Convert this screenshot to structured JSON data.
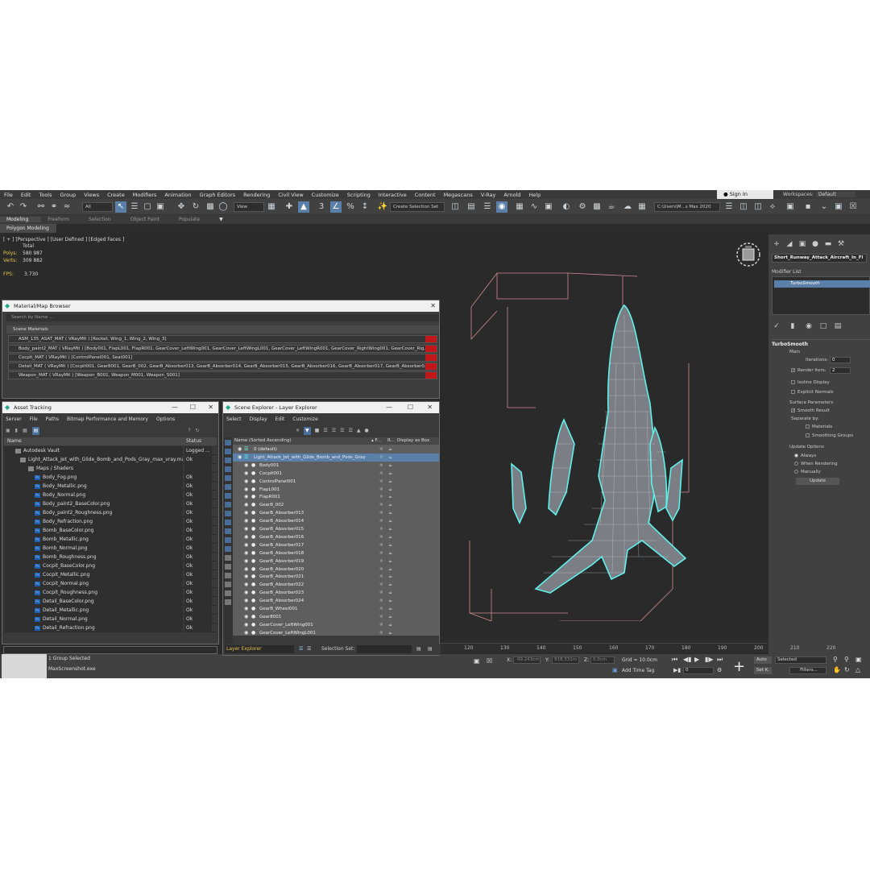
{
  "menu": [
    "File",
    "Edit",
    "Tools",
    "Group",
    "Views",
    "Create",
    "Modifiers",
    "Animation",
    "Graph Editors",
    "Rendering",
    "Civil View",
    "Customize",
    "Scripting",
    "Interactive",
    "Content",
    "Megascans",
    "V-Ray",
    "Arnold",
    "Help"
  ],
  "signin": "Sign In",
  "workspaces_label": "Workspaces:",
  "workspace_value": "Default",
  "toolbar": {
    "filter_all": "All",
    "view_drop": "View",
    "create_selection_set": "Create Selection Set",
    "project_path": "C:\\Users\\M...s Max 2020"
  },
  "ribbon_tabs": [
    "Modeling",
    "Freeform",
    "Selection",
    "Object Paint",
    "Populate"
  ],
  "ribbon_sub": "Polygon Modeling",
  "viewport": {
    "label": "[ + ] [Perspective ] [User Defined ] [Edged Faces ]",
    "total_label": "Total",
    "polys_label": "Polys:",
    "polys_value": "580 987",
    "verts_label": "Verts:",
    "verts_value": "309 882",
    "fps_label": "FPS:",
    "fps_value": "3.730"
  },
  "right_panel": {
    "object_name": "Short_Runway_Attack_Aircraft_In_Fl",
    "modifier_list_label": "Modifier List",
    "modifier": "TurboSmooth",
    "rollout_title": "TurboSmooth",
    "main_label": "Main",
    "iterations_label": "Iterations:",
    "iterations_value": "0",
    "render_iters_label": "Render Iters:",
    "render_iters_value": "2",
    "isoline": "Isoline Display",
    "explicit": "Explicit Normals",
    "surface_params": "Surface Parameters",
    "smooth_result": "Smooth Result",
    "separate_by": "Separate by:",
    "materials": "Materials",
    "smoothing_groups": "Smoothing Groups",
    "update_options": "Update Options",
    "always": "Always",
    "when_rendering": "When Rendering",
    "manually": "Manually",
    "update_btn": "Update"
  },
  "material_browser": {
    "title": "Material/Map Browser",
    "search": "Search by Name ...",
    "section": "Scene Materials",
    "rows": [
      "ASM_135_ASAT_MAT  ( VRayMtl )  [Rocket, Wing_1, Wing_2, Wing_3]",
      "Body_paint2_MAT  ( VRayMtl )  [Body001, FlapL001, FlapR001, GearCover_LeftWing001, GearCover_LeftWingL001, GearCover_LeftWingR001, GearCover_RightWing001, GearCover_Rig...",
      "Cocpit_MAT  ( VRayMtl )  [ControlPanel001, Seat001]",
      "Detail_MAT  ( VRayMtl )  [Cocpit001, Gear8001, GearB_002, GearB_Absorber013, GearB_Absorber014, GearB_Absorber015, GearB_Absorber016, GearB_Absorber017, GearB_Absorber0...",
      "Weapon_MAT  ( VRayMtl )  [Weapon_B001, Weapon_M001, Weapon_S001]"
    ]
  },
  "asset_tracking": {
    "title": "Asset Tracking",
    "menu": [
      "Server",
      "File",
      "Paths",
      "Bitmap Performance and Memory",
      "Options"
    ],
    "col_name": "Name",
    "col_status": "Status",
    "rows": [
      {
        "name": "Autodesk Vault",
        "status": "Logged ..."
      },
      {
        "name": "Light_Attack_Jet_with_Glide_Bomb_and_Pods_Gray_max_vray.max",
        "status": "Ok"
      },
      {
        "name": "Maps / Shaders",
        "status": ""
      },
      {
        "name": "Body_Fog.png",
        "status": "Ok"
      },
      {
        "name": "Body_Metallic.png",
        "status": "Ok"
      },
      {
        "name": "Body_Normal.png",
        "status": "Ok"
      },
      {
        "name": "Body_paint2_BaseColor.png",
        "status": "Ok"
      },
      {
        "name": "Body_paint2_Roughness.png",
        "status": "Ok"
      },
      {
        "name": "Body_Refraction.png",
        "status": "Ok"
      },
      {
        "name": "Bomb_BaseColor.png",
        "status": "Ok"
      },
      {
        "name": "Bomb_Metallic.png",
        "status": "Ok"
      },
      {
        "name": "Bomb_Normal.png",
        "status": "Ok"
      },
      {
        "name": "Bomb_Roughness.png",
        "status": "Ok"
      },
      {
        "name": "Cocpit_BaseColor.png",
        "status": "Ok"
      },
      {
        "name": "Cocpit_Metallic.png",
        "status": "Ok"
      },
      {
        "name": "Cocpit_Normal.png",
        "status": "Ok"
      },
      {
        "name": "Cocpit_Roughness.png",
        "status": "Ok"
      },
      {
        "name": "Detail_BaseColor.png",
        "status": "Ok"
      },
      {
        "name": "Detail_Metallic.png",
        "status": "Ok"
      },
      {
        "name": "Detail_Normal.png",
        "status": "Ok"
      },
      {
        "name": "Detail_Refraction.png",
        "status": "Ok"
      }
    ]
  },
  "scene_explorer": {
    "title": "Scene Explorer - Layer Explorer",
    "menu": [
      "Select",
      "Display",
      "Edit",
      "Customize"
    ],
    "col_name": "Name (Sorted Ascending)",
    "col_f": "▴ F...",
    "col_r": "R...",
    "col_box": "Display as Box",
    "rows": [
      "0 (default)",
      "Light_Attack_Jet_with_Glide_Bomb_and_Pods_Gray",
      "Body001",
      "Cocpit001",
      "ControlPanel001",
      "FlapL001",
      "FlapR001",
      "GearB_002",
      "GearB_Absorber013",
      "GearB_Absorber014",
      "GearB_Absorber015",
      "GearB_Absorber016",
      "GearB_Absorber017",
      "GearB_Absorber018",
      "GearB_Absorber019",
      "GearB_Absorber020",
      "GearB_Absorber021",
      "GearB_Absorber022",
      "GearB_Absorber023",
      "GearB_Absorber024",
      "GearB_Wheel001",
      "Gear8001",
      "GearCover_LeftWing001",
      "GearCover_LeftWingL001"
    ],
    "bottom_layer": "Layer Explorer",
    "selection_set": "Selection Set:"
  },
  "timeline_ticks": [
    "120",
    "130",
    "140",
    "150",
    "160",
    "170",
    "180",
    "190",
    "200",
    "210",
    "220"
  ],
  "status": {
    "selected": "1 Group Selected",
    "script": "MaxScreenshot.exe",
    "x_label": "X:",
    "x_value": "-99,243cm",
    "y_label": "Y:",
    "y_value": "918,331m",
    "z_label": "Z:",
    "z_value": "0.0cm",
    "grid": "Grid = 10.0cm",
    "add_time_tag": "Add Time Tag",
    "auto": "Auto",
    "selected_drop": "Selected",
    "setk": "Set K.",
    "filters": "Filters...",
    "frame": "0"
  }
}
